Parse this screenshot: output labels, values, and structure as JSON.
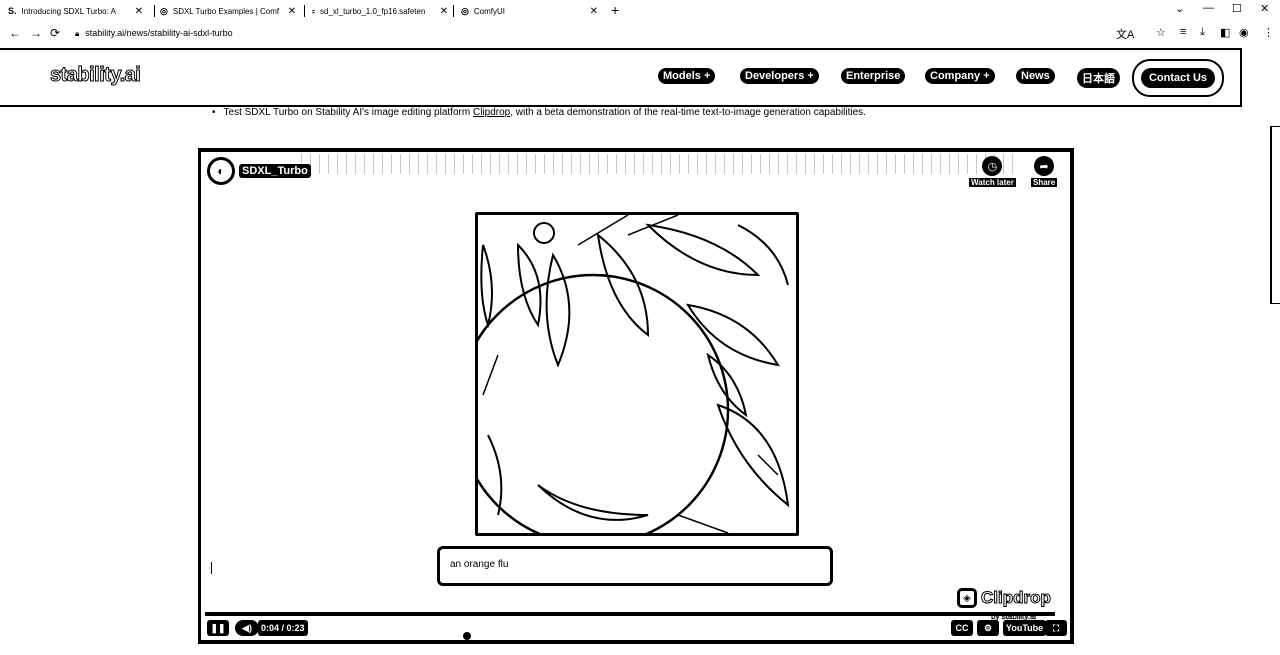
{
  "browser": {
    "tabs": [
      {
        "icon": "S.",
        "title": "Introducing SDXL Turbo: A",
        "close": "✕"
      },
      {
        "icon": "◎",
        "title": "SDXL Turbo Examples | Comf",
        "close": "✕"
      },
      {
        "icon": "⸗",
        "title": "sd_xl_turbo_1.0_fp16.safeten",
        "close": "✕"
      },
      {
        "icon": "◎",
        "title": "ComfyUI",
        "close": "✕"
      }
    ],
    "new_tab": "+",
    "window_controls": {
      "dropdown": "⌄",
      "minimize": "—",
      "maximize": "☐",
      "close": "✕"
    },
    "nav": {
      "back": "←",
      "forward": "→",
      "reload": "⟳"
    },
    "url": "stability.ai/news/stability-ai-sdxl-turbo",
    "extensions": [
      "文A",
      "☆",
      "≡",
      "⤓",
      "◧",
      "◉",
      "⋮"
    ]
  },
  "site": {
    "logo": "stability.ai",
    "nav": [
      {
        "label": "Models",
        "caret": "+"
      },
      {
        "label": "Developers",
        "caret": "+"
      },
      {
        "label": "Enterprise",
        "caret": ""
      },
      {
        "label": "Company",
        "caret": "+"
      },
      {
        "label": "News",
        "caret": ""
      },
      {
        "label": "日本語",
        "caret": ""
      }
    ],
    "contact": "Contact Us"
  },
  "article": {
    "bullet_prefix": "Test SDXL Turbo on Stability AI's image editing platform ",
    "bullet_link": "Clipdrop",
    "bullet_suffix": ", with a beta demonstration of the real-time text-to-image generation capabilities."
  },
  "video": {
    "title": "SDXL_Turbo",
    "watch_later": "Watch later",
    "share": "Share",
    "prompt_value": "an orange flu",
    "brand": "Clipdrop",
    "brand_sub": "by stability.ai",
    "time_current": "0:04",
    "time_total": "0:23",
    "time_display": "0:04 / 0:23",
    "progress_fraction": 0.174,
    "platform": "YouTube"
  }
}
